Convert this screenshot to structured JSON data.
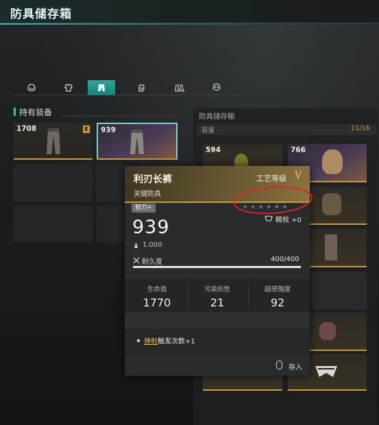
{
  "title": "防具储存箱",
  "tabs": [
    {
      "name": "helmet",
      "icon": "helmet-icon"
    },
    {
      "name": "body-armor",
      "icon": "armor-icon"
    },
    {
      "name": "pants",
      "icon": "pants-icon"
    },
    {
      "name": "gloves",
      "icon": "glove-icon"
    },
    {
      "name": "boots",
      "icon": "boots-icon"
    },
    {
      "name": "mask",
      "icon": "mask-icon"
    }
  ],
  "left_section": {
    "label": "持有装备",
    "cards": [
      {
        "value": "1708",
        "badge": "E"
      },
      {
        "value": "939"
      }
    ]
  },
  "right_panel": {
    "title": "防具储存箱",
    "capacity_label": "容量",
    "capacity": "11/16",
    "cards": [
      {
        "value": "594"
      },
      {
        "value": "766"
      }
    ]
  },
  "tooltip": {
    "name": "利刃长裤",
    "type": "关键防具",
    "craft_label": "工艺等级",
    "craft_level": "V",
    "tag": "耐力+",
    "stars": "✧✧✧✧✧✧",
    "refine": "精校 +0",
    "power": "939",
    "weight": "1.000",
    "durability_label": "耐久度",
    "durability": "400/400",
    "durability_fraction": 1.0,
    "stats": [
      {
        "label": "生命值",
        "value": "1770"
      },
      {
        "label": "污染抗性",
        "value": "21"
      },
      {
        "label": "超感强度",
        "value": "92"
      }
    ],
    "perk_keyword": "弹射",
    "perk_text": "触发次数+1",
    "store_label": "存入"
  },
  "colors": {
    "accent": "#3fc0b4",
    "gold": "#c89c47",
    "annotation": "#e42222"
  }
}
